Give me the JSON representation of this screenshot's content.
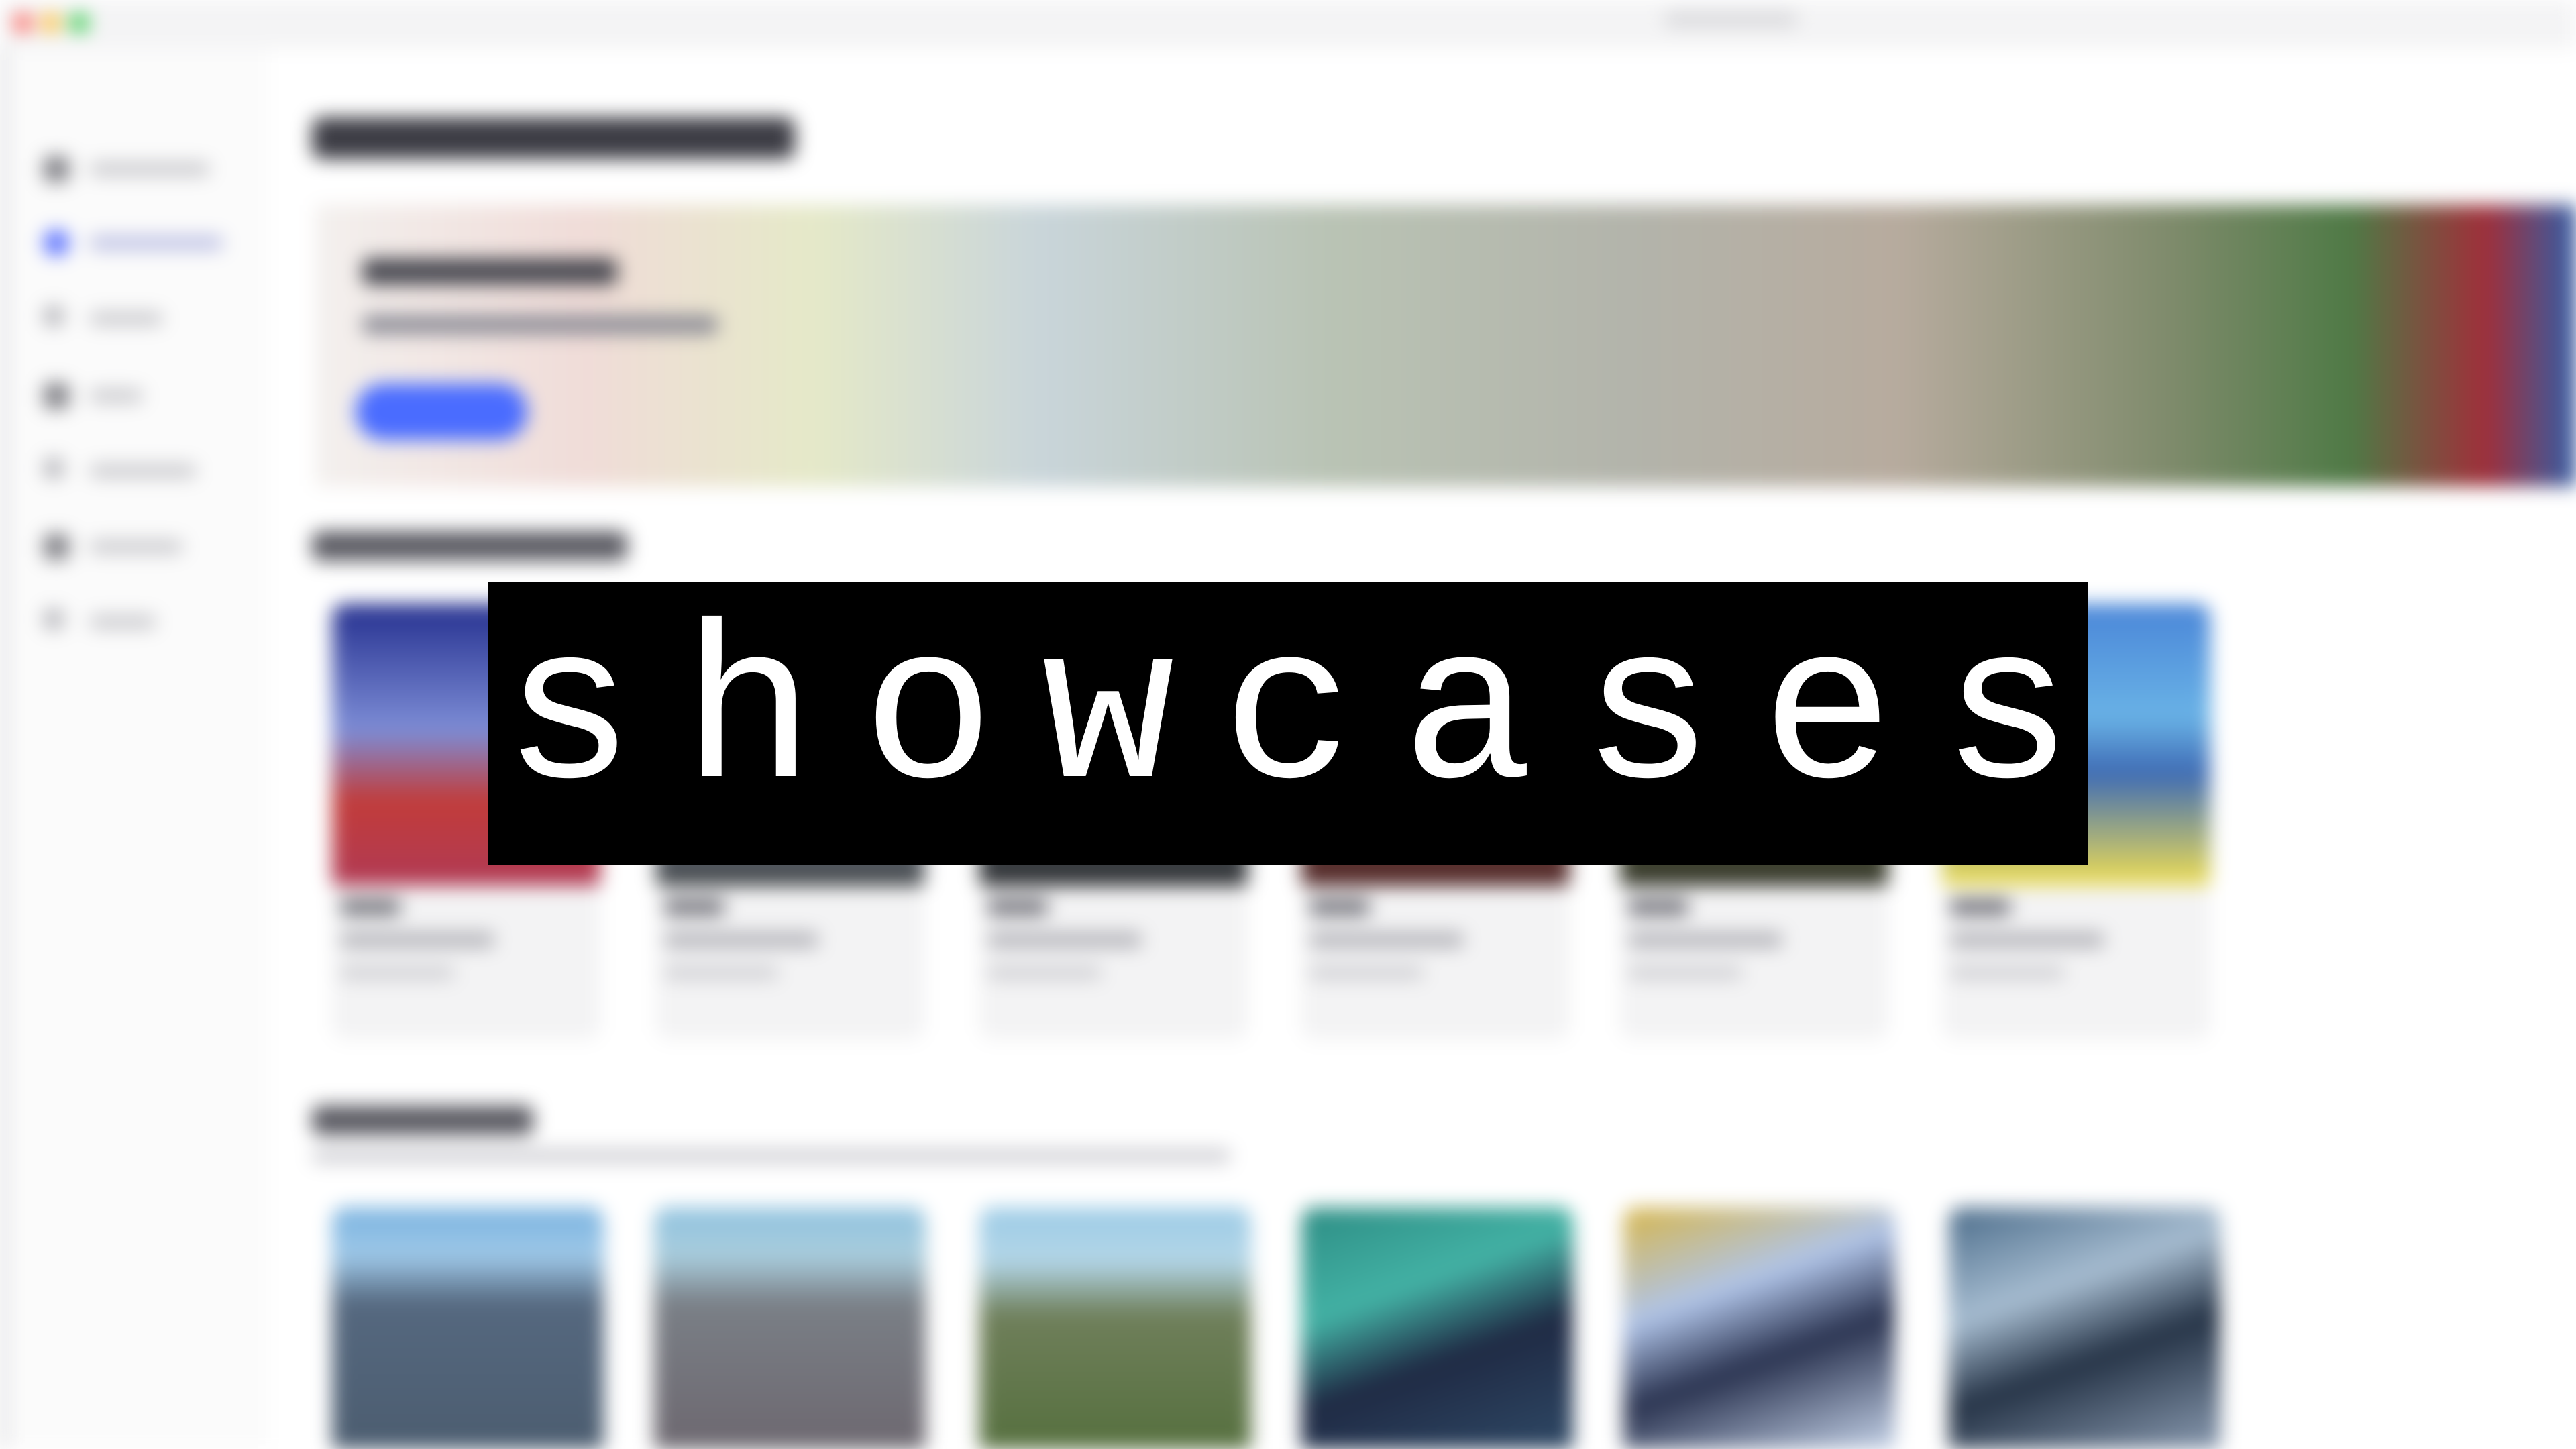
{
  "overlay": {
    "text": "showcases"
  },
  "background_ui": {
    "blurred": true,
    "window": {
      "traffic_light_colors": [
        "#ff5f57",
        "#febc2e",
        "#28c840"
      ]
    },
    "sidebar": {
      "items": [
        {
          "icon": "home-icon"
        },
        {
          "icon": "discover-icon",
          "active": true
        },
        {
          "icon": "plus-icon"
        },
        {
          "icon": "folder-icon"
        },
        {
          "icon": "plus-icon"
        },
        {
          "icon": "folder-icon"
        },
        {
          "icon": "plus-icon"
        }
      ]
    },
    "hero": {
      "accent_color": "#4a6cff"
    },
    "featured_cards_count": 6,
    "new_tiles_count": 6
  }
}
